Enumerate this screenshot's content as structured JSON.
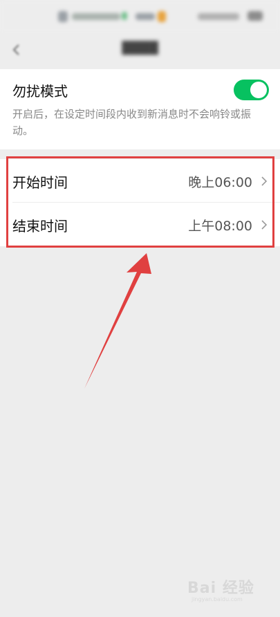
{
  "colors": {
    "accent": "#07c160",
    "annotation": "#e04040",
    "background": "#ededed",
    "card": "#ffffff"
  },
  "dnd": {
    "title": "勿扰模式",
    "description": "开启后，在设定时间段内收到新消息时不会响铃或振动。",
    "enabled": true
  },
  "schedule": {
    "start_label": "开始时间",
    "start_value": "晚上06:00",
    "end_label": "结束时间",
    "end_value": "上午08:00"
  },
  "icons": {
    "back": "back-arrow-icon",
    "chevron": "chevron-right-icon"
  },
  "watermark": {
    "brand": "Bai 经验",
    "url": "jingyan.baidu.com"
  }
}
